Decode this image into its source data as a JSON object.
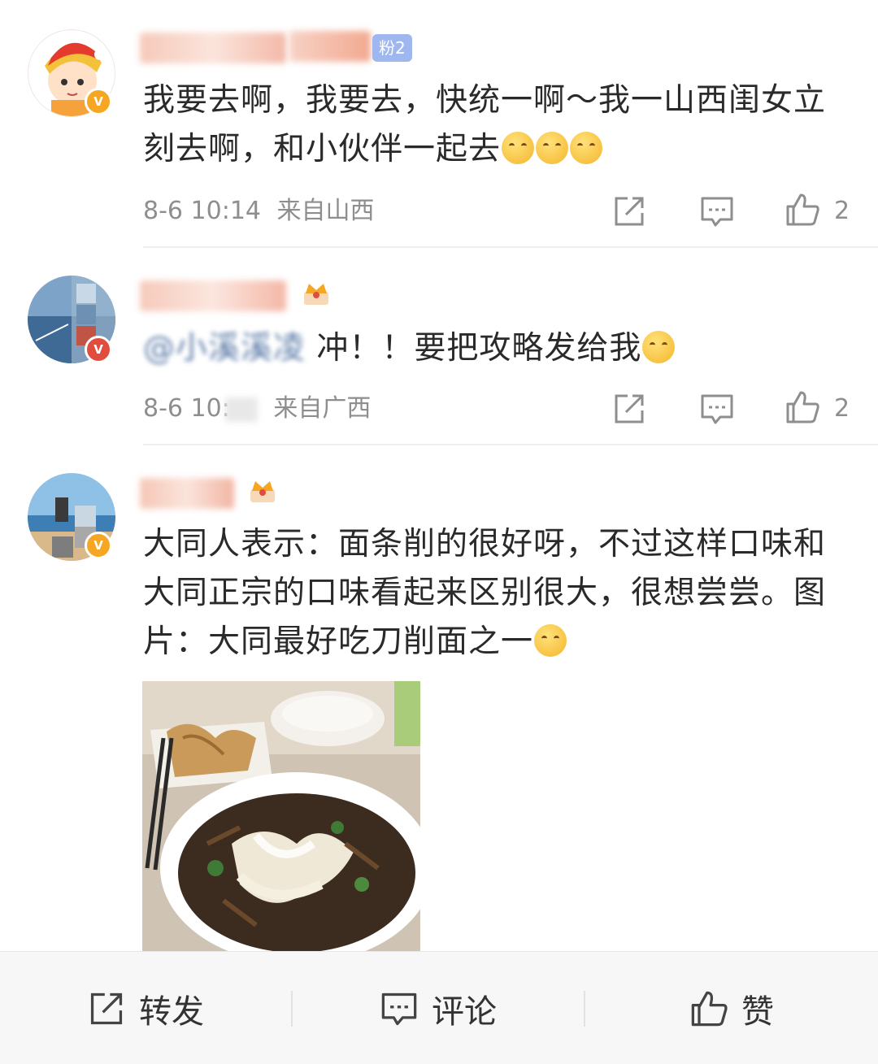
{
  "comments": [
    {
      "fan_badge": "粉2",
      "text": "我要去啊，我要去，快统一啊～我一山西闺女立刻去啊，和小伙伴一起去",
      "time": "8-6 10:14",
      "location": "来自山西",
      "likes": "2"
    },
    {
      "mention": "@小溪溪凌",
      "text": " 冲！！要把攻略发给我",
      "time_prefix": "8-6 10:",
      "location": "来自广西",
      "likes": "2"
    },
    {
      "text": "大同人表示：面条削的很好呀，不过这样口味和大同正宗的口味看起来区别很大，很想尝尝。图片：大同最好吃刀削面之一"
    }
  ],
  "bottom_bar": {
    "repost_label": "转发",
    "comment_label": "评论",
    "like_label": "赞"
  },
  "icons": {
    "repost": "repost-icon",
    "comment": "comment-icon",
    "like": "thumbs-up-icon",
    "verified": "verified-badge-icon",
    "crown": "crown-icon",
    "emoji": "emoji-icon"
  },
  "colors": {
    "text": "#2a2a2a",
    "meta": "#8e8e8e",
    "mention": "#5b7ba8",
    "fan_badge": "#9fb7ef",
    "verified_orange": "#f5a623",
    "bottom_bar_bg": "#f7f7f7"
  }
}
